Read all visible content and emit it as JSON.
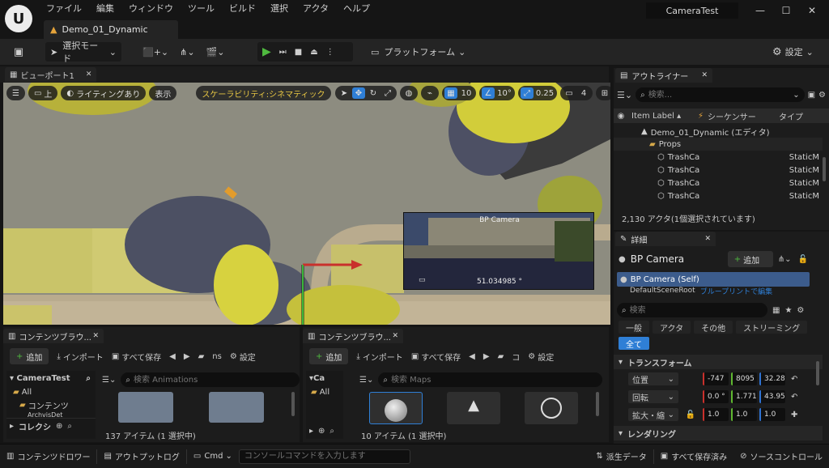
{
  "app": {
    "logo": "U",
    "project_title": "CameraTest",
    "level_tab": "Demo_01_Dynamic"
  },
  "menu": [
    "ファイル",
    "編集",
    "ウィンドウ",
    "ツール",
    "ビルド",
    "選択",
    "アクタ",
    "ヘルプ"
  ],
  "window_controls": {
    "minimize": "—",
    "maximize": "☐",
    "close": "✕"
  },
  "toolbar": {
    "select_mode": "選択モード",
    "platform": "プラットフォーム",
    "settings": "設定"
  },
  "viewport": {
    "tab": "ビューポート1",
    "view_top": "上",
    "lighting": "ライティングあり",
    "show": "表示",
    "scalability": "スケーラビリティ:シネマティック",
    "grid_snap": "10",
    "rot_snap": "10°",
    "scale_snap": "0.25",
    "camera_speed": "4",
    "pip_title": "BP Camera",
    "pip_value": "51.034985 °"
  },
  "outliner": {
    "tab": "アウトライナー",
    "search_placeholder": "検索...",
    "col_label": "Item Label ▴",
    "col_sequencer": "シーケンサー",
    "col_type": "タイプ",
    "rows": [
      {
        "label": "Demo_01_Dynamic (エディタ)",
        "type": ""
      },
      {
        "label": "Props",
        "type": ""
      },
      {
        "label": "TrashCa",
        "type": "StaticM"
      },
      {
        "label": "TrashCa",
        "type": "StaticM"
      },
      {
        "label": "TrashCa",
        "type": "StaticM"
      },
      {
        "label": "TrashCa",
        "type": "StaticM"
      }
    ],
    "status": "2,130 アクタ(1個選択されています)"
  },
  "details": {
    "tab": "詳細",
    "actor": "BP Camera",
    "add": "追加",
    "component_self": "BP Camera (Self)",
    "component_next": "DefaultSceneRoot",
    "component_next_suffix": "ブループリントで編集",
    "search_placeholder": "検索",
    "filters": [
      "一般",
      "アクタ",
      "その他",
      "ストリーミング",
      "全て"
    ],
    "section_transform": "トランスフォーム",
    "location": {
      "label": "位置",
      "x": "-747",
      "y": "8095",
      "z": "32.28"
    },
    "rotation": {
      "label": "回転",
      "x": "0.0 °",
      "y": "1.771",
      "z": "43.95"
    },
    "scale": {
      "label": "拡大・縮",
      "x": "1.0",
      "y": "1.0",
      "z": "1.0"
    },
    "section_rendering": "レンダリング"
  },
  "cb1": {
    "tab": "コンテンツブラウ...",
    "add": "追加",
    "import": "インポート",
    "save_all": "すべて保存",
    "path_tail": "ns",
    "settings": "設定",
    "tree_root": "CameraTest",
    "tree_all": "All",
    "tree_content": "コンテンツ",
    "tree_sub": "ArchvisDet",
    "collections": "コレクシ",
    "search_placeholder": "検索 Animations",
    "count": "137 アイテム (1 選択中)"
  },
  "cb2": {
    "tab": "コンテンツブラウ...",
    "add": "追加",
    "import": "インポート",
    "save_all": "すべて保存",
    "path_tail": "コ",
    "settings": "設定",
    "tree_root": "Ca",
    "tree_all": "All",
    "search_placeholder": "検索 Maps",
    "count": "10 アイテム (1 選択中)"
  },
  "statusbar": {
    "content_drawer": "コンテンツドロワー",
    "output_log": "アウトプットログ",
    "cmd": "Cmd",
    "console_placeholder": "コンソールコマンドを入力します",
    "derived_data": "派生データ",
    "all_saved": "すべて保存済み",
    "source_control": "ソースコントロール"
  },
  "colors": {
    "accent": "#2f7fd6",
    "play_green": "#4fba3f",
    "scalability_yellow": "#e7c643"
  }
}
